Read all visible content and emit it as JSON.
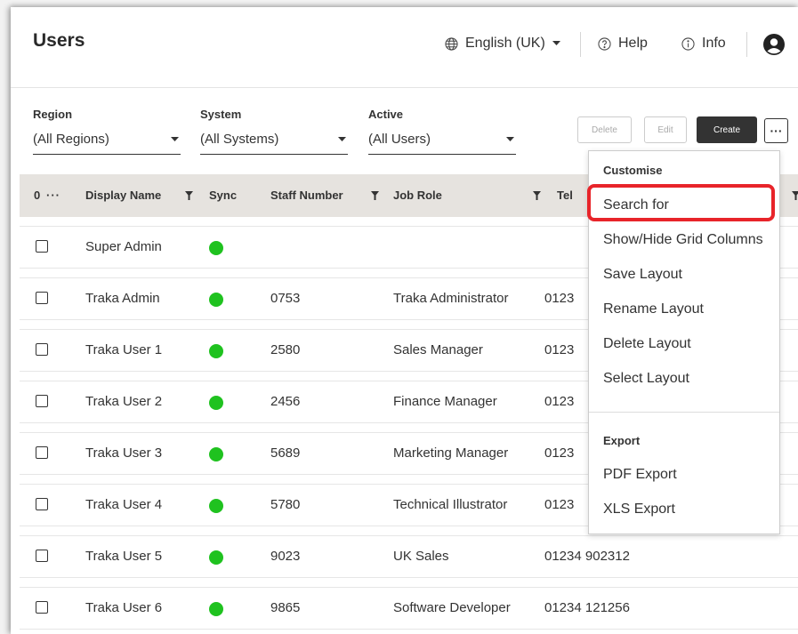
{
  "header": {
    "title": "Users",
    "language": "English (UK)",
    "help": "Help",
    "info": "Info"
  },
  "filters": [
    {
      "label": "Region",
      "value": "(All Regions)"
    },
    {
      "label": "System",
      "value": "(All Systems)"
    },
    {
      "label": "Active",
      "value": "(All Users)"
    }
  ],
  "toolbar": {
    "delete_label": "Delete",
    "edit_label": "Edit",
    "create_label": "Create",
    "more_label": "···"
  },
  "grid": {
    "selected_count": "0",
    "select_menu": "···",
    "columns": [
      "Display Name",
      "Sync",
      "Staff Number",
      "Job Role",
      "Tel"
    ],
    "rows": [
      {
        "name": "Super Admin",
        "staff": "",
        "role": "",
        "tel": ""
      },
      {
        "name": "Traka Admin",
        "staff": "0753",
        "role": "Traka Administrator",
        "tel": "0123"
      },
      {
        "name": "Traka User 1",
        "staff": "2580",
        "role": "Sales Manager",
        "tel": "0123"
      },
      {
        "name": "Traka User 2",
        "staff": "2456",
        "role": "Finance Manager",
        "tel": "0123"
      },
      {
        "name": "Traka User 3",
        "staff": "5689",
        "role": "Marketing Manager",
        "tel": "0123"
      },
      {
        "name": "Traka User 4",
        "staff": "5780",
        "role": "Technical Illustrator",
        "tel": "0123"
      },
      {
        "name": "Traka User 5",
        "staff": "9023",
        "role": "UK Sales",
        "tel": "01234 902312"
      },
      {
        "name": "Traka User 6",
        "staff": "9865",
        "role": "Software Developer",
        "tel": "01234 121256"
      }
    ]
  },
  "menu": {
    "customise_heading": "Customise",
    "customise_items": [
      "Search for",
      "Show/Hide Grid Columns",
      "Save Layout",
      "Rename Layout",
      "Delete Layout",
      "Select Layout"
    ],
    "export_heading": "Export",
    "export_items": [
      "PDF Export",
      "XLS Export"
    ]
  },
  "colors": {
    "sync_active": "#1fc21f",
    "highlight": "#e8242a",
    "create_button": "#333333"
  }
}
